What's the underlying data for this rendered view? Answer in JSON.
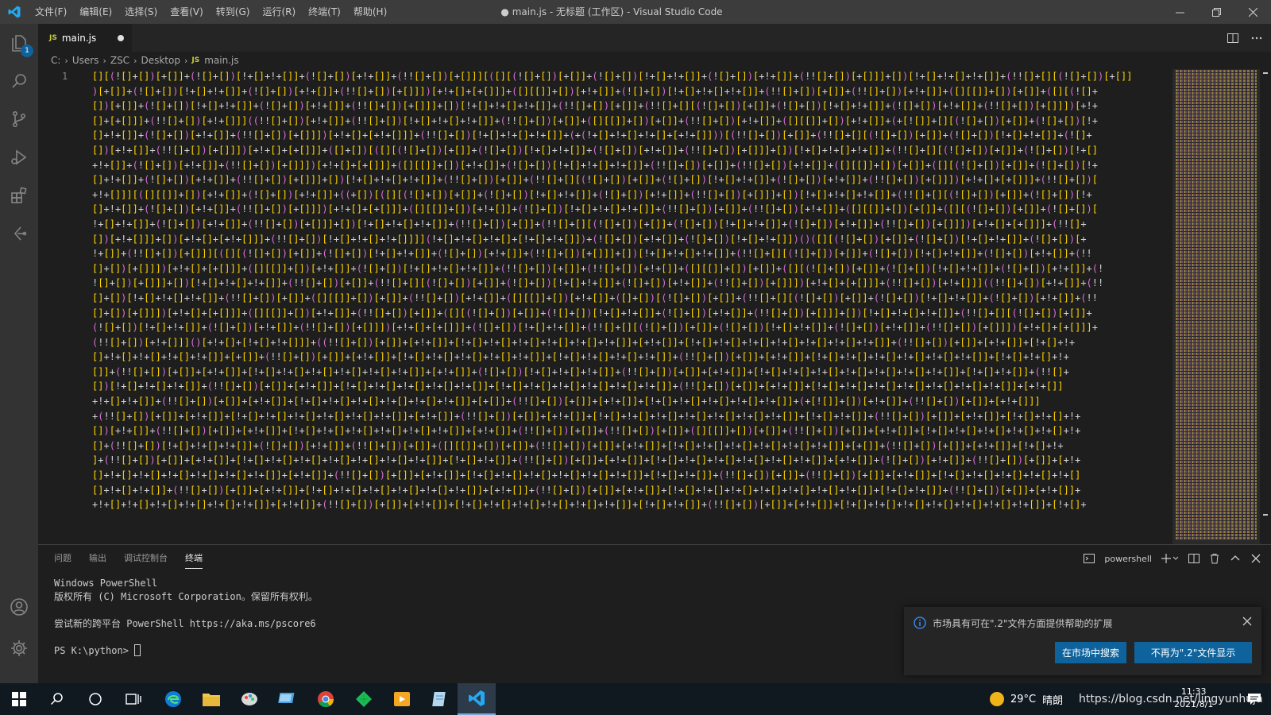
{
  "window": {
    "title": "● main.js - 无标题 (工作区) - Visual Studio Code",
    "menu": [
      "文件(F)",
      "编辑(E)",
      "选择(S)",
      "查看(V)",
      "转到(G)",
      "运行(R)",
      "终端(T)",
      "帮助(H)"
    ]
  },
  "activity": {
    "explorer_badge": "1"
  },
  "tab": {
    "icon": "JS",
    "label": "main.js"
  },
  "breadcrumb": {
    "segments": [
      "C:",
      "Users",
      "ZSC",
      "Desktop"
    ],
    "file_icon": "JS",
    "file": "main.js"
  },
  "editor": {
    "line_number": "1",
    "wrapped_lines": [
      "[][(![]+[])[+[]]+(![]+[])[!+[]+!+[]]+(![]+[])[+!+[]]+(!![]+[])[+[]]][([][(![]+[])[+[]]+(![]+[])[!+[]+!+[]]+(![]+[])[+!+[]]+(!![]+[])[+[]]]+[])[!+[]+!+[]+!+[]]+(!![]+[][(![]+[])[+[]]",
      ")[+[]]+(![]+[])[!+[]+!+[]]+(![]+[])[+!+[]]+(!![]+[])[+[]]])[+!+[]+[+[]]]+([][[]]+[])[+!+[]]+(![]+[])[!+[]+!+[]+!+[]]+(!![]+[])[+[]]+(!![]+[])[+!+[]]+([][[]]+[])[+[]]+([][(![]+",
      "[])[+[]]+(![]+[])[!+[]+!+[]]+(![]+[])[+!+[]]+(!![]+[])[+[]]]+[])[!+[]+!+[]+!+[]]+(!![]+[])[+[]]+(!![]+[][(![]+[])[+[]]+(![]+[])[!+[]+!+[]]+(![]+[])[+!+[]]+(!![]+[])[+[]]])[+!+",
      "[]+[+[]]]+(!![]+[])[+!+[]]]((!![]+[])[+!+[]]+(!![]+[])[!+[]+!+[]+!+[]]+(!![]+[])[+[]]+([][[]]+[])[+[]]+(!![]+[])[+!+[]]+([][[]]+[])[+!+[]]+(+[![]]+[][(![]+[])[+[]]+(![]+[])[!+",
      "[]+!+[]]+(![]+[])[+!+[]]+(!![]+[])[+[]]])[+!+[]+[+!+[]]]+(!![]+[])[!+[]+!+[]+!+[]]+(+(!+[]+!+[]+!+[]+[+!+[]]))[(!![]+[])[+[]]+(!![]+[][(![]+[])[+[]]+(![]+[])[!+[]+!+[]]+(![]+",
      "[])[+!+[]]+(!![]+[])[+[]]])[+!+[]+[+[]]]+([]+[])[([][(![]+[])[+[]]+(![]+[])[!+[]+!+[]]+(![]+[])[+!+[]]+(!![]+[])[+[]]]+[])[!+[]+!+[]+!+[]]+(!![]+[][(![]+[])[+[]]+(![]+[])[!+[]",
      "+!+[]]+(![]+[])[+!+[]]+(!![]+[])[+[]]])[+!+[]+[+[]]]+([][[]]+[])[+!+[]]+(![]+[])[!+[]+!+[]+!+[]]+(!![]+[])[+[]]+(!![]+[])[+!+[]]+([][[]]+[])[+[]]+([][(![]+[])[+[]]+(![]+[])[!+",
      "[]+!+[]]+(![]+[])[+!+[]]+(!![]+[])[+[]]]+[])[!+[]+!+[]+!+[]]+(!![]+[])[+[]]+(!![]+[][(![]+[])[+[]]+(![]+[])[!+[]+!+[]]+(![]+[])[+!+[]]+(!![]+[])[+[]]])[+!+[]+[+[]]]+(!![]+[])[",
      "+!+[]]][([][[]]+[])[+!+[]]+(![]+[])[+!+[]]+((+[])[([][(![]+[])[+[]]+(![]+[])[!+[]+!+[]]+(![]+[])[+!+[]]+(!![]+[])[+[]]]+[])[!+[]+!+[]+!+[]]+(!![]+[][(![]+[])[+[]]+(![]+[])[!+",
      "[]+!+[]]+(![]+[])[+!+[]]+(!![]+[])[+[]]])[+!+[]+[+[]]]+([][[]]+[])[+!+[]]+(![]+[])[!+[]+!+[]+!+[]]+(!![]+[])[+[]]+(!![]+[])[+!+[]]+([][[]]+[])[+[]]+([][(![]+[])[+[]]+(![]+[])[",
      "!+[]+!+[]]+(![]+[])[+!+[]]+(!![]+[])[+[]]]+[])[!+[]+!+[]+!+[]]+(!![]+[])[+[]]+(!![]+[][(![]+[])[+[]]+(![]+[])[!+[]+!+[]]+(![]+[])[+!+[]]+(!![]+[])[+[]]])[+!+[]+[+[]]]+(!![]+",
      "[])[+!+[]]]+[])[+!+[]+[+!+[]]]+(!![]+[])[!+[]+!+[]+!+[]]]](!+[]+!+[]+!+[]+[!+[]+!+[]])+(![]+[])[+!+[]]+(![]+[])[!+[]+!+[]])()([][(![]+[])[+[]]+(![]+[])[!+[]+!+[]]+(![]+[])[+",
      "!+[]]+(!![]+[])[+[]]][([][(![]+[])[+[]]+(![]+[])[!+[]+!+[]]+(![]+[])[+!+[]]+(!![]+[])[+[]]]+[])[!+[]+!+[]+!+[]]+(!![]+[][(![]+[])[+[]]+(![]+[])[!+[]+!+[]]+(![]+[])[+!+[]]+(!!",
      "[]+[])[+[]]])[+!+[]+[+[]]]+([][[]]+[])[+!+[]]+(![]+[])[!+[]+!+[]+!+[]]+(!![]+[])[+[]]+(!![]+[])[+!+[]]+([][[]]+[])[+[]]+([][(![]+[])[+[]]+(![]+[])[!+[]+!+[]]+(![]+[])[+!+[]]+(!",
      "![]+[])[+[]]]+[])[!+[]+!+[]+!+[]]+(!![]+[])[+[]]+(!![]+[][(![]+[])[+[]]+(![]+[])[!+[]+!+[]]+(![]+[])[+!+[]]+(!![]+[])[+[]]])[+!+[]+[+[]]]+(!![]+[])[+!+[]]]((!![]+[])[+!+[]]+(!!",
      "[]+[])[!+[]+!+[]+!+[]]+(!![]+[])[+[]]+([][[]]+[])[+[]]+(!![]+[])[+!+[]]+([][[]]+[])[+!+[]]+([]+[])[(![]+[])[+[]]+(!![]+[][(![]+[])[+[]]+(![]+[])[!+[]+!+[]]+(![]+[])[+!+[]]+(!!",
      "[]+[])[+[]]])[+!+[]+[+[]]]+([][[]]+[])[+!+[]]+(!![]+[])[+[]]+([][(![]+[])[+[]]+(![]+[])[!+[]+!+[]]+(![]+[])[+!+[]]+(!![]+[])[+[]]]+[])[!+[]+!+[]+!+[]]+(!![]+[][(![]+[])[+[]]+",
      "(![]+[])[!+[]+!+[]]+(![]+[])[+!+[]]+(!![]+[])[+[]]])[+!+[]+[+[]]]+(![]+[])[!+[]+!+[]]+(!![]+[][(![]+[])[+[]]+(![]+[])[!+[]+!+[]]+(![]+[])[+!+[]]+(!![]+[])[+[]]])[+!+[]+[+[]]]+",
      "(!![]+[])[+!+[]]]()[+!+[]+[!+[]+!+[]]]+((!![]+[])[+[]]+[+!+[]]+[!+[]+!+[]+!+[]+!+[]+!+[]+!+[]]+[+!+[]]+[!+[]+!+[]+!+[]+!+[]+!+[]+!+[]+!+[]]+(!![]+[])[+[]]+[+!+[]]+[!+[]+!+",
      "[]+!+[]+!+[]+!+[]+!+[]]+[+[]]+(!![]+[])[+[]]+[+!+[]]+[!+[]+!+[]+!+[]+!+[]+!+[]]+[!+[]+!+[]+!+[]+!+[]]+(!![]+[])[+[]]+[+!+[]]+[!+[]+!+[]+!+[]+!+[]+!+[]+!+[]]+[!+[]+!+[]+!+",
      "[]]+(!![]+[])[+[]]+[+!+[]]+[!+[]+!+[]+!+[]+!+[]+!+[]+!+[]]+[+!+[]]+(![]+[])[!+[]+!+[]+!+[]]+(!![]+[])[+[]]+[+!+[]]+[!+[]+!+[]+!+[]+!+[]+!+[]+!+[]+!+[]]+[!+[]+!+[]]+(!![]+",
      "[])[!+[]+!+[]+!+[]]+(!![]+[])[+[]]+[+!+[]]+[!+[]+!+[]+!+[]+!+[]+!+[]]+[!+[]+!+[]+!+[]+!+[]+!+[]+!+[]]+(!![]+[])[+[]]+[+!+[]]+[!+[]+!+[]+!+[]+!+[]+!+[]+!+[]+!+[]]+[+!+[]]",
      "+!+[]+!+[]]+(!![]+[])[+[]]+[+!+[]]+[!+[]+!+[]+!+[]+!+[]+!+[]+!+[]]+[+[]]+(!![]+[])[+[]]+[+!+[]]+[!+[]+!+[]+!+[]+!+[]+!+[]]+(+[![]]+[])[+!+[]]+(!![]+[])[+[]]+[+!+[]]]",
      "+(!![]+[])[+[]]+[+!+[]]+[!+[]+!+[]+!+[]+!+[]+!+[]+!+[]]+[+!+[]]+(!![]+[])[+[]]+[+!+[]]+[!+[]+!+[]+!+[]+!+[]+!+[]+!+[]+!+[]]+[!+[]+!+[]]+(!![]+[])[+[]]+[+!+[]]+[!+[]+!+[]+!+",
      "[])[+!+[]]+(!![]+[])[+[]]+[+!+[]]+[!+[]+!+[]+!+[]+!+[]+!+[]+!+[]]+[+!+[]]+(!![]+[])[+[]]+(!![]+[])[+[]]+([][[]]+[])[+[]]+(!![]+[])[+[]]+[+!+[]]+[!+[]+!+[]+!+[]+!+[]+!+[]+!+",
      "[]+(!![]+[])[!+[]+!+[]+!+[]]+(![]+[])[+!+[]]+(!![]+[])[+[]]+([][[]]+[])[+[]]+(!![]+[])[+[]]+[+!+[]]+[!+[]+!+[]+!+[]+!+[]+!+[]+!+[]]+[+[]]+(!![]+[])[+[]]+[+!+[]]+[!+[]+!+",
      "]+(!![]+[])[+[]]+[+!+[]]+[!+[]+!+[]+!+[]+!+[]+!+[]+!+[]+!+[]]+[!+[]+!+[]]+(!![]+[])[+[]]+[+!+[]]+[!+[]+!+[]+!+[]+!+[]+!+[]+!+[]]+[+!+[]]+(![]+[])[+!+[]]+(!![]+[])[+[]]+[+!+",
      "[]+!+[]+!+[]+!+[]+!+[]+!+[]+!+[]]+[+!+[]]+(!![]+[])[+[]]+[+!+[]]+[!+[]+!+[]+!+[]+!+[]+!+[]+!+[]]+[!+[]+!+[]]+(!![]+[])[+[]]+(!![]+[])[+[]]+[+!+[]]+[!+[]+!+[]+!+[]+!+[]+!+[]",
      "[]+!+[]+!+[]]+(!![]+[])[+[]]+[+!+[]]+[!+[]+!+[]+!+[]+!+[]+!+[]+!+[]]+[+!+[]]+(!![]+[])[+[]]+[+!+[]]+[!+[]+!+[]+!+[]+!+[]+!+[]+!+[]+!+[]]+[!+[]+!+[]]+(!![]+[])[+[]]+[+!+[]]+",
      "+!+[]+!+[]+!+[]+!+[]+!+[]+!+[]]+[+!+[]]+(!![]+[])[+[]]+[+!+[]]+[!+[]+!+[]+!+[]+!+[]+!+[]+!+[]]+[!+[]+!+[]]+(!![]+[])[+[]]+[+!+[]]+[!+[]+!+[]+!+[]+!+[]+!+[]+!+[]+!+[]]+[!+[]+"
    ]
  },
  "panel": {
    "tabs": [
      "问题",
      "输出",
      "调试控制台",
      "终端"
    ],
    "active_tab": 3,
    "shell": "powershell",
    "terminal_lines": [
      "Windows PowerShell",
      "版权所有 (C) Microsoft Corporation。保留所有权利。",
      "",
      "尝试新的跨平台 PowerShell https://aka.ms/pscore6",
      ""
    ],
    "prompt": "PS K:\\python> "
  },
  "notification": {
    "message": "市场具有可在\".2\"文件方面提供帮助的扩展",
    "search_button": "在市场中搜索",
    "dismiss_button": "不再为\".2\"文件显示"
  },
  "taskbar": {
    "temperature": "29°C",
    "weather": "晴朗",
    "watermark": "https://blog.csdn.net/lingyunhuja",
    "time": "11:33",
    "date": "2021/8/1"
  },
  "colors": {
    "bracket": "#ffd700",
    "paren": "#da70d6",
    "accent": "#0e639c",
    "titlebar": "#3c3c3c",
    "activitybar": "#333333"
  }
}
